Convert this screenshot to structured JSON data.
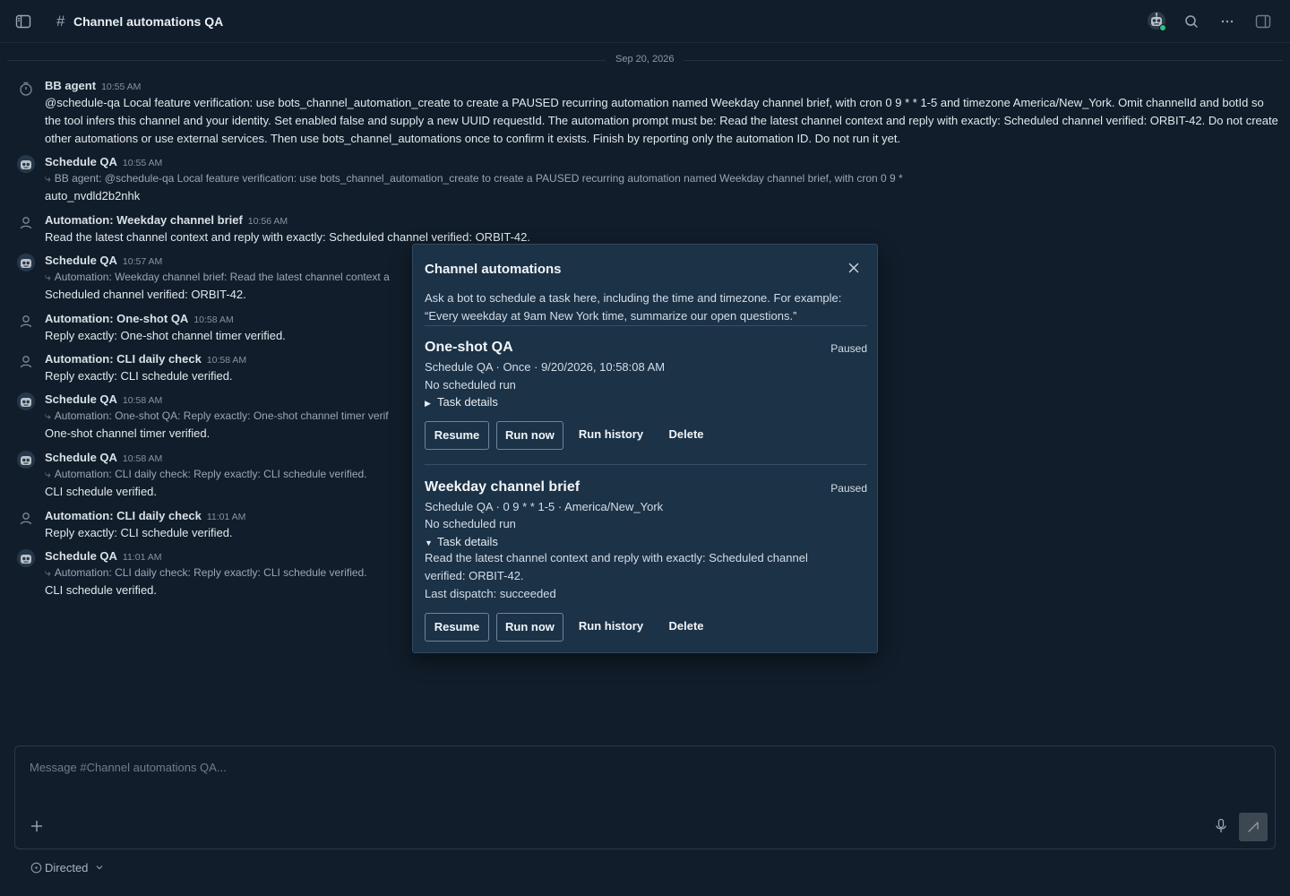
{
  "header": {
    "hash": "#",
    "title": "Channel automations QA"
  },
  "date_separator": "Sep 20, 2026",
  "messages": [
    {
      "author": "BB agent",
      "time": "10:55 AM",
      "body": "@schedule-qa Local feature verification: use bots_channel_automation_create to create a PAUSED recurring automation named Weekday channel brief, with cron 0 9 * * 1-5 and timezone America/New_York. Omit channelId and botId so the tool infers this channel and your identity. Set enabled false and supply a new UUID requestId. The automation prompt must be: Read the latest channel context and reply with exactly: Scheduled channel verified: ORBIT-42. Do not create other automations or use external services. Then use bots_channel_automations once to confirm it exists. Finish by reporting only the automation ID. Do not run it yet."
    },
    {
      "author": "Schedule QA",
      "time": "10:55 AM",
      "reply": "BB agent: @schedule-qa Local feature verification: use bots_channel_automation_create to create a PAUSED recurring automation named Weekday channel brief, with cron 0 9 *",
      "body": "auto_nvdld2b2nhk"
    },
    {
      "author": "Automation: Weekday channel brief",
      "time": "10:56 AM",
      "body": "Read the latest channel context and reply with exactly: Scheduled channel verified: ORBIT-42."
    },
    {
      "author": "Schedule QA",
      "time": "10:57 AM",
      "reply": "Automation: Weekday channel brief: Read the latest channel context a",
      "body": "Scheduled channel verified: ORBIT-42."
    },
    {
      "author": "Automation: One-shot QA",
      "time": "10:58 AM",
      "body": "Reply exactly: One-shot channel timer verified."
    },
    {
      "author": "Automation: CLI daily check",
      "time": "10:58 AM",
      "body": "Reply exactly: CLI schedule verified."
    },
    {
      "author": "Schedule QA",
      "time": "10:58 AM",
      "reply": "Automation: One-shot QA: Reply exactly: One-shot channel timer verif",
      "body": "One-shot channel timer verified."
    },
    {
      "author": "Schedule QA",
      "time": "10:58 AM",
      "reply": "Automation: CLI daily check: Reply exactly: CLI schedule verified.",
      "body": "CLI schedule verified."
    },
    {
      "author": "Automation: CLI daily check",
      "time": "11:01 AM",
      "body": "Reply exactly: CLI schedule verified."
    },
    {
      "author": "Schedule QA",
      "time": "11:01 AM",
      "reply": "Automation: CLI daily check: Reply exactly: CLI schedule verified.",
      "body": "CLI schedule verified."
    }
  ],
  "modal": {
    "title": "Channel automations",
    "intro": "Ask a bot to schedule a task here, including the time and timezone. For example: “Every weekday at 9am New York time, summarize our open questions.”",
    "automations": [
      {
        "name": "One-shot QA",
        "status": "Paused",
        "meta": "Schedule QA · Once · 9/20/2026, 10:58:08 AM",
        "next_run": "No scheduled run",
        "details_label": "Task details",
        "details_expanded": false,
        "buttons": {
          "resume": "Resume",
          "run_now": "Run now",
          "run_history": "Run history",
          "delete": "Delete"
        }
      },
      {
        "name": "Weekday channel brief",
        "status": "Paused",
        "meta": "Schedule QA · 0 9 * * 1-5 · America/New_York",
        "next_run": "No scheduled run",
        "details_label": "Task details",
        "details_expanded": true,
        "task_prompt": "Read the latest channel context and reply with exactly: Scheduled channel verified: ORBIT-42.",
        "last_dispatch": "Last dispatch: succeeded",
        "buttons": {
          "resume": "Resume",
          "run_now": "Run now",
          "run_history": "Run history",
          "delete": "Delete"
        }
      }
    ]
  },
  "composer": {
    "placeholder": "Message #Channel automations QA..."
  },
  "mode": {
    "label": "Directed"
  },
  "colors": {
    "background": "#111d2a",
    "modal_background": "#1b3247",
    "online": "#2ec27e"
  },
  "icons": [
    "sidebar-toggle-icon",
    "search-icon",
    "more-icon",
    "panel-right-icon",
    "close-icon",
    "plus-icon",
    "microphone-icon",
    "send-icon",
    "chevron-down-icon",
    "bot-icon",
    "user-icon",
    "clock-agent-icon",
    "reply-arrow-icon"
  ]
}
